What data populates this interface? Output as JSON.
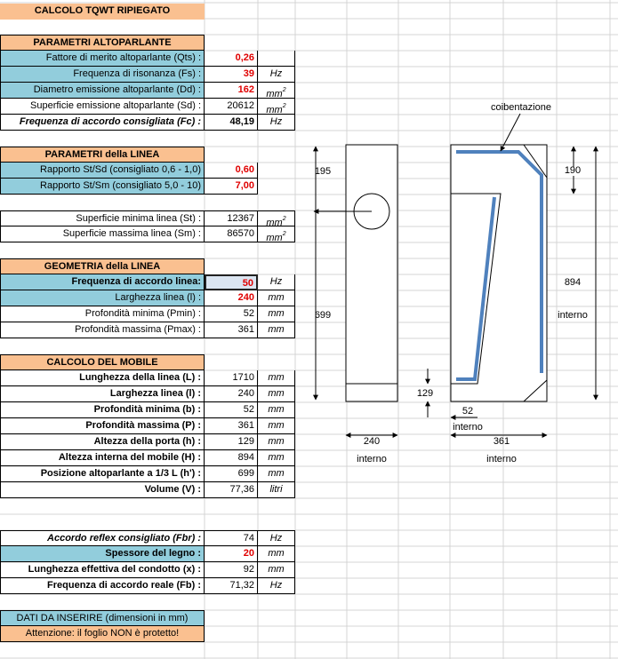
{
  "title": "CALCOLO TQWT RIPIEGATO",
  "sec_altoparlante": {
    "header": "PARAMETRI ALTOPARLANTE",
    "rows": [
      {
        "label": "Fattore di merito altoparlante (Qts) :",
        "value": "0,26",
        "unit": ""
      },
      {
        "label": "Frequenza di risonanza (Fs) :",
        "value": "39",
        "unit": "Hz"
      },
      {
        "label": "Diametro emissione altoparlante  (Dd) :",
        "value": "162",
        "unit": "mm"
      },
      {
        "label": "Superficie emissione altoparlante (Sd) :",
        "value": "20612",
        "unit": "mm"
      },
      {
        "label": "Frequenza di accordo consigliata (Fc) :",
        "value": "48,19",
        "unit": "Hz"
      }
    ]
  },
  "sec_linea": {
    "header": "PARAMETRI della LINEA",
    "rows": [
      {
        "label": "Rapporto St/Sd  (consigliato 0,6 - 1,0)",
        "value": "0,60"
      },
      {
        "label": "Rapporto St/Sm  (consigliato 5,0 - 10)",
        "value": "7,00"
      }
    ]
  },
  "sec_superfici": {
    "rows": [
      {
        "label": "Superficie minima linea (St) :",
        "value": "12367",
        "unit": "mm"
      },
      {
        "label": "Superficie massima linea (Sm) :",
        "value": "86570",
        "unit": "mm"
      }
    ]
  },
  "sec_geometria": {
    "header": "GEOMETRIA della LINEA",
    "rows": [
      {
        "label": "Frequenza di accordo linea:",
        "value": "50",
        "unit": "Hz"
      },
      {
        "label": "Larghezza linea (l) :",
        "value": "240",
        "unit": "mm"
      },
      {
        "label": "Profondità minima (Pmin) :",
        "value": "52",
        "unit": "mm"
      },
      {
        "label": "Profondità massima (Pmax) :",
        "value": "361",
        "unit": "mm"
      }
    ]
  },
  "sec_mobile": {
    "header": "CALCOLO DEL MOBILE",
    "rows": [
      {
        "label": "Lunghezza della linea (L) :",
        "value": "1710",
        "unit": "mm"
      },
      {
        "label": "Larghezza linea (l) :",
        "value": "240",
        "unit": "mm"
      },
      {
        "label": "Profondità minima (b) :",
        "value": "52",
        "unit": "mm"
      },
      {
        "label": "Profondità massima (P) :",
        "value": "361",
        "unit": "mm"
      },
      {
        "label": "Altezza della porta (h) :",
        "value": "129",
        "unit": "mm"
      },
      {
        "label": "Altezza interna del mobile (H) :",
        "value": "894",
        "unit": "mm"
      },
      {
        "label": "Posizione altoparlante a 1/3 L (h') :",
        "value": "699",
        "unit": "mm"
      },
      {
        "label": "Volume (V) :",
        "value": "77,36",
        "unit": "litri"
      }
    ]
  },
  "sec_reflex": {
    "rows": [
      {
        "label": "Accordo reflex consigliato (Fbr) :",
        "value": "74",
        "unit": "Hz"
      },
      {
        "label": "Spessore del legno :",
        "value": "20",
        "unit": "mm"
      },
      {
        "label": "Lunghezza effettiva del condotto (x) :",
        "value": "92",
        "unit": "mm"
      },
      {
        "label": "Frequenza di accordo reale (Fb) :",
        "value": "71,32",
        "unit": "Hz"
      }
    ]
  },
  "legend": {
    "input_note": "DATI DA INSERIRE (dimensioni in mm)",
    "warning": "Attenzione: il foglio NON è protetto!"
  },
  "diagram": {
    "front_top_dim": "195",
    "front_height_dim": "699",
    "port_dim": "129",
    "front_width_dim": "240",
    "front_width_note": "interno",
    "side_top_dim": "190",
    "side_height_dim": "894",
    "side_height_note": "interno",
    "side_min_dim": "52",
    "side_min_note": "interno",
    "side_max_dim": "361",
    "side_max_note": "interno",
    "insulation_label": "coibentazione"
  },
  "colors": {
    "header_orange": "#fac090",
    "input_blue": "#92cddc",
    "input_red": "#e00000",
    "insulation_blue": "#4f81bd"
  }
}
